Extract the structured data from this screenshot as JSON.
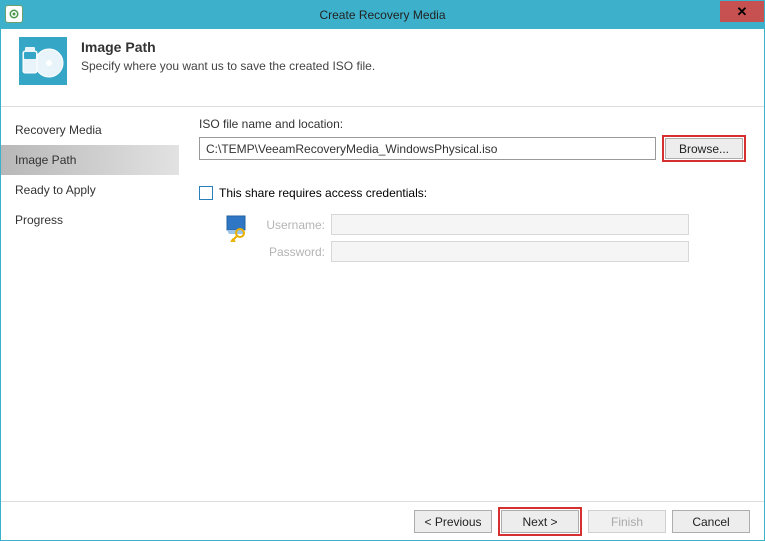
{
  "window": {
    "title": "Create Recovery Media"
  },
  "header": {
    "title": "Image Path",
    "subtitle": "Specify where you want us to save the created ISO file."
  },
  "sidebar": {
    "items": [
      {
        "label": "Recovery Media"
      },
      {
        "label": "Image Path"
      },
      {
        "label": "Ready to Apply"
      },
      {
        "label": "Progress"
      }
    ]
  },
  "content": {
    "iso_label": "ISO file name and location:",
    "iso_value": "C:\\TEMP\\VeeamRecoveryMedia_WindowsPhysical.iso",
    "browse": "Browse...",
    "share_chk": "This share requires access credentials:",
    "username_label": "Username:",
    "password_label": "Password:"
  },
  "footer": {
    "previous": "< Previous",
    "next": "Next >",
    "finish": "Finish",
    "cancel": "Cancel"
  }
}
